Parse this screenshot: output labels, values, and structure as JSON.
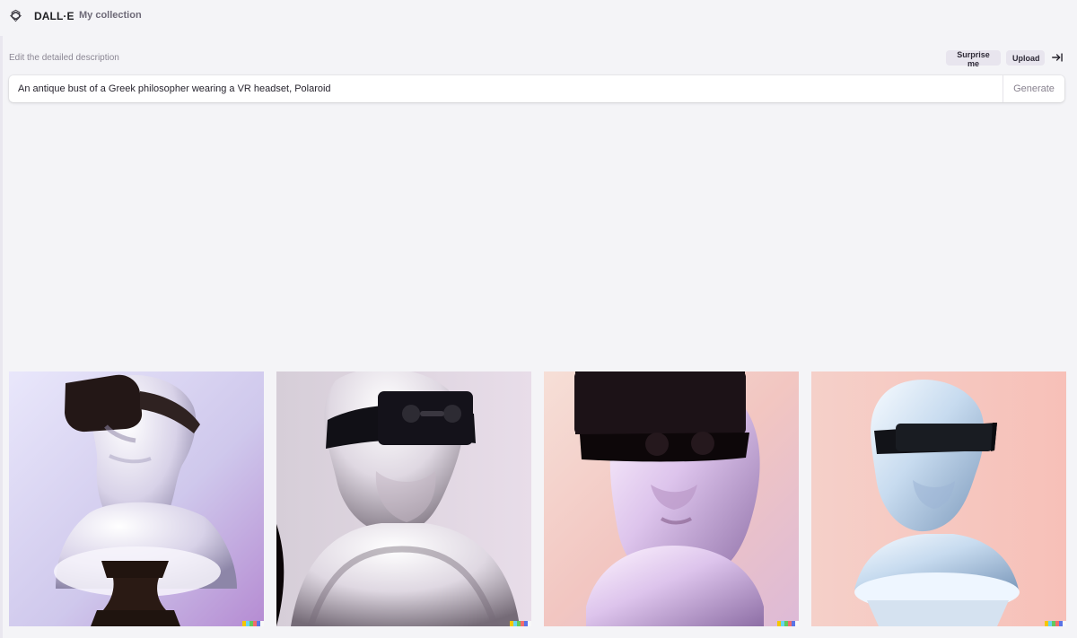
{
  "app": {
    "name": "DALL·E",
    "nav_link": "My collection"
  },
  "prompt": {
    "label": "Edit the detailed description",
    "value": "An antique bust of a Greek philosopher wearing a VR headset, Polaroid",
    "surprise_label": "Surprise me",
    "upload_label": "Upload",
    "generate_label": "Generate"
  },
  "icons": {
    "logo": "openai-logo-icon",
    "collapse": "arrow-right-to-line-icon"
  },
  "colors": {
    "page_background": "#f4f4f7",
    "chip_background": "#e8e5ee",
    "muted_text": "#8b8794",
    "nav_text": "#6e6a78"
  },
  "images": [
    {
      "name": "generated-image-1",
      "background": "#d8d3ec"
    },
    {
      "name": "generated-image-2",
      "background": "#d8ccd9"
    },
    {
      "name": "generated-image-3",
      "background": "#f0cbc7"
    },
    {
      "name": "generated-image-4",
      "background": "#f5c6bf"
    }
  ]
}
